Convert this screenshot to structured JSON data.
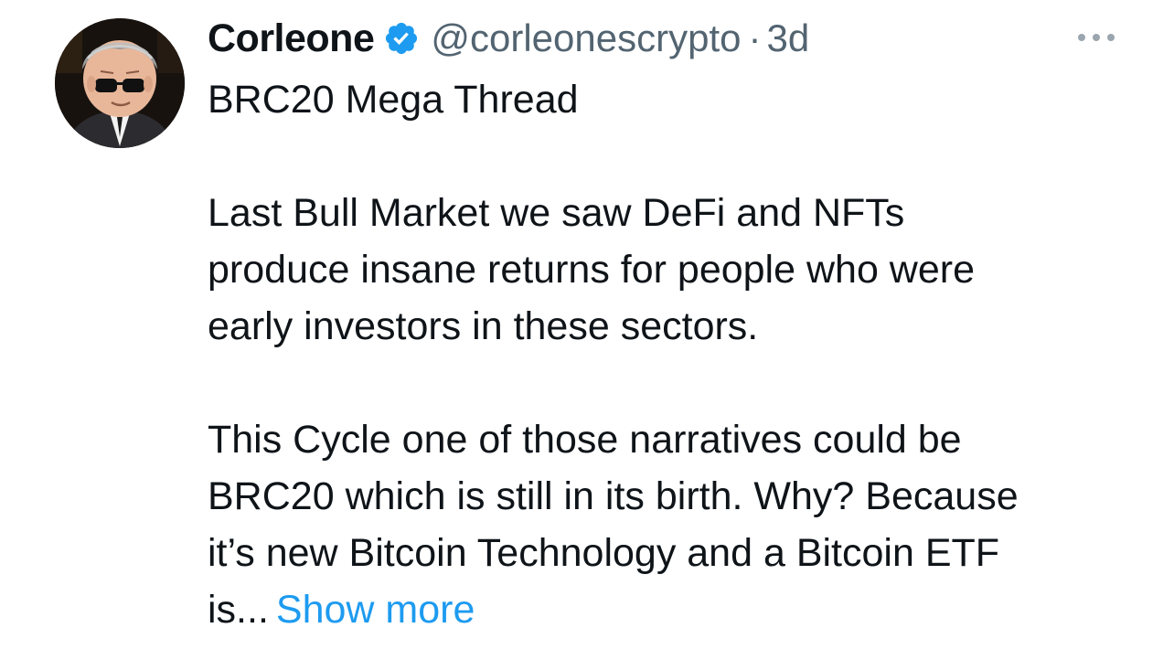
{
  "tweet": {
    "author_name": "Corleone",
    "handle": "@corleonescrypto",
    "separator": "·",
    "time": "3d",
    "lines": {
      "title": "BRC20 Mega Thread",
      "p1_l1": "Last Bull Market we saw DeFi and NFTs",
      "p1_l2": "produce insane returns for people who were",
      "p1_l3": "early investors in these sectors.",
      "p2_l1": "This Cycle one of those narratives could be",
      "p2_l2": "BRC20 which is still in its birth. Why? Because",
      "p2_l3": "it’s new Bitcoin Technology and a Bitcoin ETF",
      "p2_l4": "is..."
    },
    "show_more_label": "Show more"
  },
  "icons": {
    "verified": "verified-badge-icon",
    "more": "more-horizontal-icon"
  },
  "colors": {
    "text": "#0f1419",
    "secondary": "#536471",
    "accent": "#1d9bf0"
  }
}
